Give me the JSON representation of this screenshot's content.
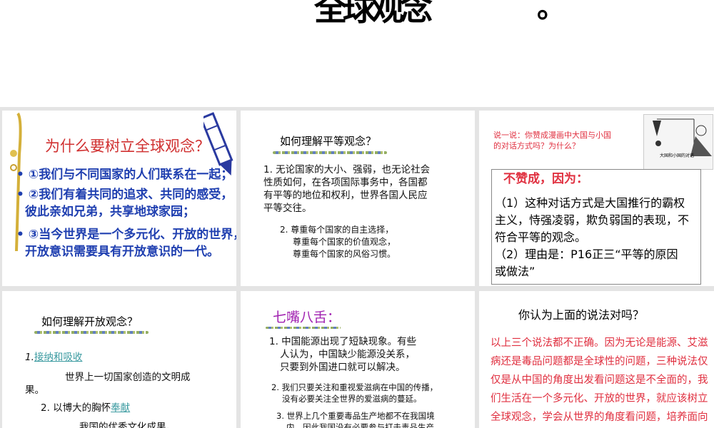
{
  "header": {
    "title": "全球观念",
    "punct": "。"
  },
  "slide1": {
    "title": "为什么要树立全球观念？",
    "points": [
      "①我们与不同国家的人们联系在一起；",
      "②我们有着共同的追求、共同的感受，",
      "彼此亲如兄弟，共享地球家园；",
      "③当今世界是一个多元化、开放的世界，",
      "开放意识需要具有开放意识的一代。"
    ]
  },
  "slide2": {
    "title": "如何理解平等观念？",
    "p1": [
      "1. 无论国家的大小、强弱，也无论社会",
      "性质如何，在各项国际事务中，各国都",
      "有平等的地位和权利，世界各国人民应",
      "平等交往。"
    ],
    "p2": [
      "2. 尊重每个国家的自主选择，",
      "尊重每个国家的价值观念，",
      "尊重每个国家的风俗习惯。"
    ]
  },
  "slide3": {
    "question": [
      "说一说：你赞成漫画中大国与小国",
      "的对话方式吗？为什么？"
    ],
    "cartoon_caption": "大国和小国的对话",
    "answer_head": "不赞成，因为：",
    "answer": [
      "（1）这种对话方式是大国推行的霸权",
      "主义，恃强凌弱，欺负弱国的表现，不",
      "符合平等的观念。",
      "（2）理由是：P16正三“平等的原因",
      "或做法”"
    ]
  },
  "slide4": {
    "title": "如何理解开放观念？",
    "n1": "1.",
    "link1": "接纳和吸收",
    "t1a": "世界上一切国家创造的文明成",
    "t1b": "果。",
    "n2": "2. 以博大的胸怀",
    "link2": "奉献",
    "t2": "我国的优秀文化成果。"
  },
  "slide5": {
    "title": "七嘴八舌：",
    "items": [
      "1. 中国能源出现了短缺现象。有些",
      "人认为，中国缺少能源没关系，",
      "只要到外国进口就可以解决。",
      "2. 我们只要关注和重视爱滋病在中国的传播，",
      "没有必要关注全世界的爱滋病的蔓延。",
      "3. 世界上几个重要毒品生产地都不在我国境",
      "内，因此我国没有必要参与打击毒品生产"
    ]
  },
  "slide6": {
    "title": "你认为上面的说法对吗？",
    "answer": [
      "以上三个说法都不正确。因为无论是能源、艾滋",
      "病还是毒品问题都是全球性的问题，三种说法仅",
      "仅是从中国的角度出发看问题这是不全面的，我",
      "们生活在一个多元化、开放的世界，就应该树立",
      "全球观念，学会从世界的角度看问题，培养面向"
    ]
  }
}
